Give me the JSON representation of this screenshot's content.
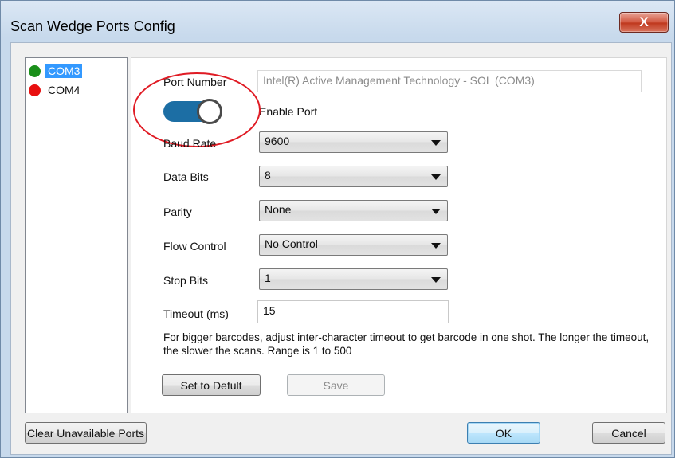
{
  "window": {
    "title": "Scan Wedge Ports Config",
    "close_glyph": "X"
  },
  "ports": [
    {
      "name": "COM3",
      "status_color": "#1a8f1a",
      "selected": true
    },
    {
      "name": "COM4",
      "status_color": "#e81010",
      "selected": false
    }
  ],
  "config": {
    "port_number_label": "Port Number",
    "port_number_value": "Intel(R) Active Management Technology - SOL (COM3)",
    "enable_port_label": "Enable Port",
    "enable_port_on": true,
    "baud_rate_label": "Baud Rate",
    "baud_rate_value": "9600",
    "data_bits_label": "Data Bits",
    "data_bits_value": "8",
    "parity_label": "Parity",
    "parity_value": "None",
    "flow_control_label": "Flow Control",
    "flow_control_value": "No Control",
    "stop_bits_label": "Stop Bits",
    "stop_bits_value": "1",
    "timeout_label": "Timeout (ms)",
    "timeout_value": "15",
    "note": "For bigger barcodes, adjust inter-character timeout to get barcode in one shot. The longer the timeout, the slower the scans. Range is 1 to 500",
    "set_default_label": "Set to Defult",
    "save_label": "Save"
  },
  "footer": {
    "clear_ports_label": "Clear Unavailable Ports",
    "ok_label": "OK",
    "cancel_label": "Cancel"
  },
  "colors": {
    "toggle_on": "#1c6ea4",
    "annotation": "#e01b24",
    "selection": "#3399ff"
  }
}
